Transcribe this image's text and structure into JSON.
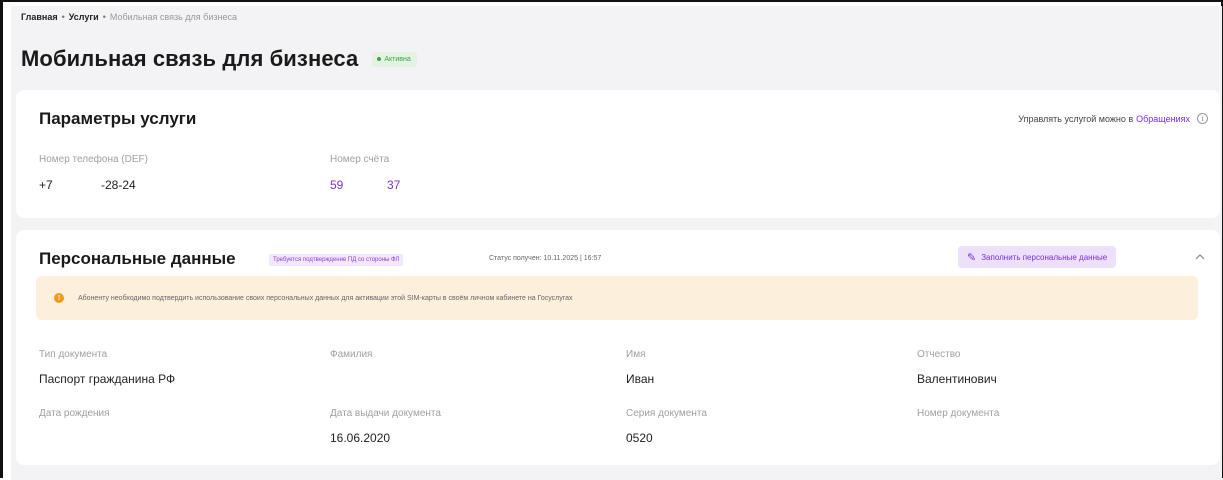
{
  "breadcrumb": {
    "home": "Главная",
    "services": "Услуги",
    "current": "Мобильная связь для бизнеса"
  },
  "page": {
    "title": "Мобильная связь для бизнеса",
    "status_badge": "Активна"
  },
  "params": {
    "title": "Параметры услуги",
    "hint_text": "Управлять услугой можно в",
    "hint_link": "Обращениях",
    "phone_label": "Номер телефона (DEF)",
    "phone_value_prefix": "+7",
    "phone_value_suffix": "-28-24",
    "account_label": "Номер счёта",
    "account_value_start": "59",
    "account_value_end": "37"
  },
  "personal": {
    "title": "Персональные данные",
    "confirm_tag": "Требуется подтверждение ПД со стороны ФЛ",
    "status_received": "Статус получен: 10.11.2025 | 16:57",
    "fill_button": "Заполнить персональные данные",
    "alert_text": "Абоненту необходимо подтвердить использование своих персональных данных для активации этой SIM-карты в своём личном кабинете на Госуслугах",
    "fields": {
      "doc_type_label": "Тип документа",
      "doc_type_value": "Паспорт гражданина РФ",
      "surname_label": "Фамилия",
      "name_label": "Имя",
      "name_value": "Иван",
      "patronymic_label": "Отчество",
      "patronymic_value": "Валентинович",
      "birth_date_label": "Дата рождения",
      "issue_date_label": "Дата выдачи документа",
      "issue_date_value": "16.06.2020",
      "doc_series_label": "Серия документа",
      "doc_series_value": "0520",
      "doc_number_label": "Номер документа"
    }
  },
  "colors": {
    "accent": "#7b2fe0",
    "active_green": "#3ea34b",
    "warning": "#f39a1d",
    "background": "#f3f3f5"
  },
  "icons": {
    "info": "info-icon",
    "pencil": "pencil-icon",
    "chevron": "chevron-up-icon",
    "warning": "warning-icon",
    "status_dot": "status-dot-icon"
  }
}
